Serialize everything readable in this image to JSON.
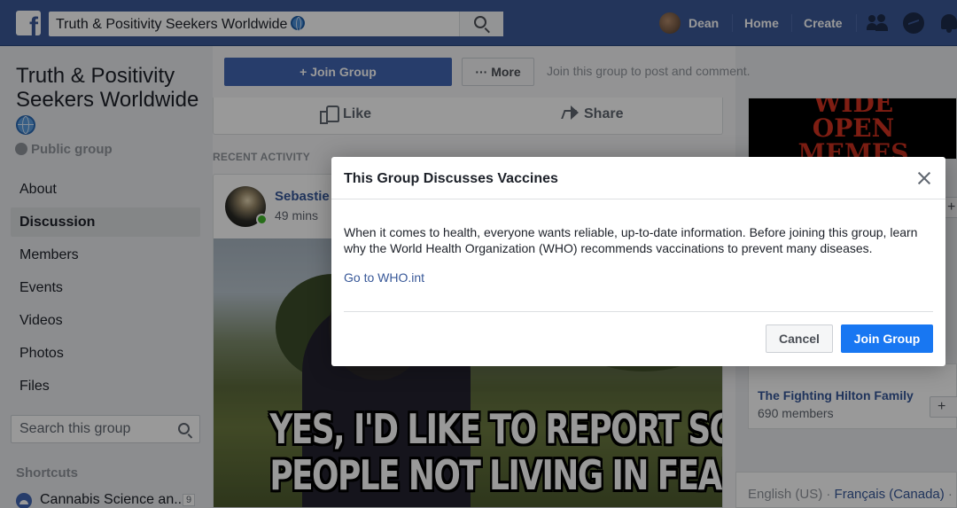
{
  "topbar": {
    "search_value": "Truth & Positivity Seekers Worldwide",
    "user_name": "Dean",
    "home": "Home",
    "create": "Create"
  },
  "group": {
    "title": "Truth & Positivity Seekers Worldwide",
    "privacy": "Public group"
  },
  "sidebar": {
    "items": [
      {
        "label": "About"
      },
      {
        "label": "Discussion"
      },
      {
        "label": "Members"
      },
      {
        "label": "Events"
      },
      {
        "label": "Videos"
      },
      {
        "label": "Photos"
      },
      {
        "label": "Files"
      }
    ],
    "active": "Discussion",
    "search_placeholder": "Search this group",
    "shortcuts_heading": "Shortcuts",
    "shortcut": {
      "label": "Cannabis Science an...",
      "count": "9"
    }
  },
  "actions": {
    "join": "+ Join Group",
    "more": "··· More",
    "join_hint": "Join this group to post and comment.",
    "like": "Like",
    "share": "Share"
  },
  "feed": {
    "recent_activity": "RECENT ACTIVITY",
    "post": {
      "author": "Sebastie",
      "time": "49 mins",
      "meme_line1": "YES, I'D LIKE TO REPORT SOME",
      "meme_line2": "PEOPLE NOT LIVING IN FEAR"
    }
  },
  "right": {
    "meme_cover_line1": "WIDE",
    "meme_cover_line2": "OPEN",
    "meme_cover_line3": "MEMES",
    "suggested_group": {
      "name": "The Fighting Hilton Family",
      "members": "690 members"
    },
    "plus": "+",
    "languages": {
      "current": "English (US)",
      "sep": " · ",
      "other": "Français (Canada)",
      "trail": " ·"
    }
  },
  "modal": {
    "title": "This Group Discusses Vaccines",
    "body": "When it comes to health, everyone wants reliable, up-to-date information. Before joining this group, learn why the World Health Organization (WHO) recommends vaccinations to prevent many diseases.",
    "link": "Go to WHO.int",
    "cancel": "Cancel",
    "join": "Join Group"
  },
  "colors": {
    "topbar": "#3b5998",
    "primary_button": "#1877f2",
    "link": "#385898"
  }
}
